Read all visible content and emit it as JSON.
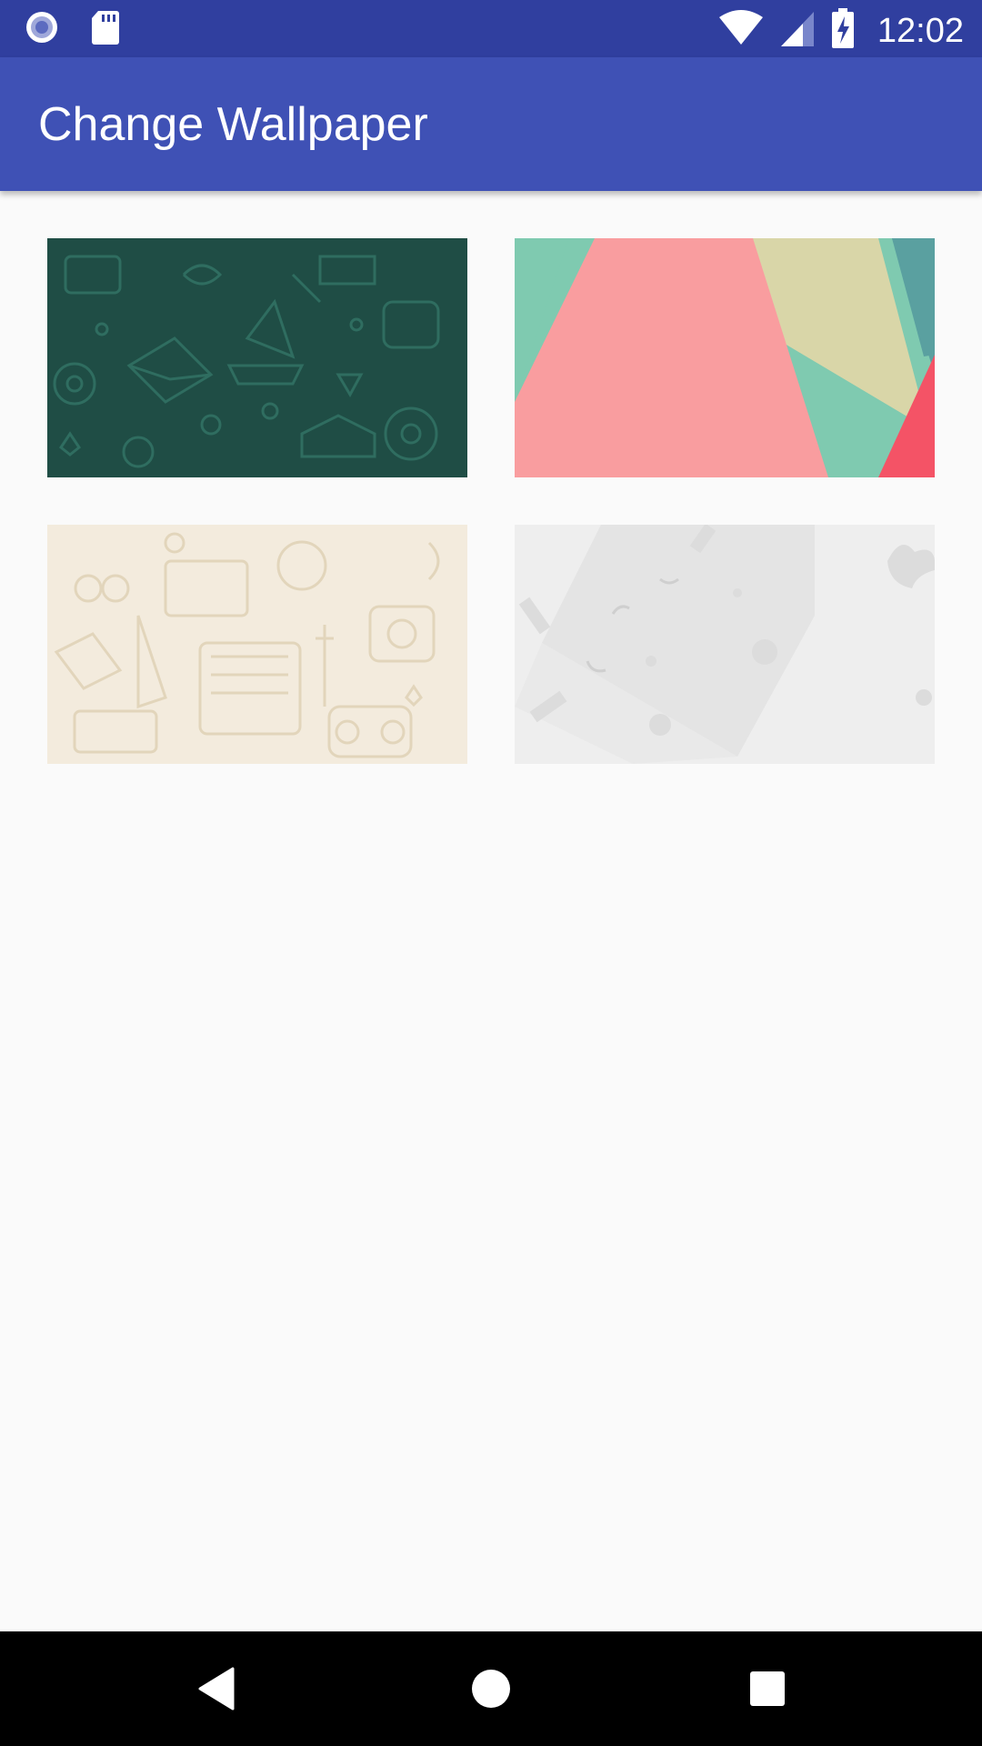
{
  "status_bar": {
    "time": "12:02",
    "icons": [
      "notification-circle-icon",
      "sd-card-icon",
      "wifi-icon",
      "cell-signal-icon",
      "battery-charging-icon"
    ]
  },
  "app_bar": {
    "title": "Change Wallpaper"
  },
  "wallpapers": [
    {
      "id": "doodle-green",
      "colors": [
        "#1f4d45",
        "#2e6b5f"
      ]
    },
    {
      "id": "material-geometric",
      "colors": [
        "#f99d9f",
        "#7fcab0",
        "#d9d6a8",
        "#f45366",
        "#5aa0a0"
      ]
    },
    {
      "id": "doodle-beige",
      "colors": [
        "#f3ebdd",
        "#e4d7bd"
      ]
    },
    {
      "id": "light-gray-pattern",
      "colors": [
        "#eeeeee",
        "#dcdcdc"
      ]
    }
  ],
  "nav_bar": {
    "back": "back-icon",
    "home": "home-icon",
    "recents": "recents-icon"
  }
}
